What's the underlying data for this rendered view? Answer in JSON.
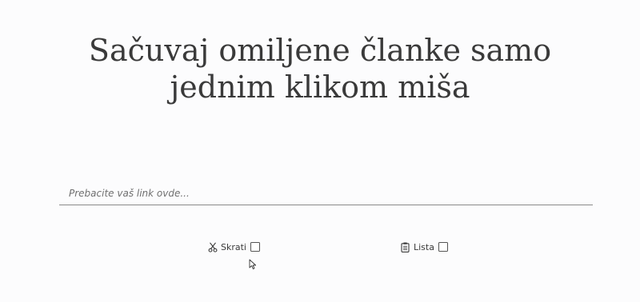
{
  "headline": {
    "line1": "Sačuvaj omiljene članke samo",
    "line2": "jednim klikom miša"
  },
  "link_input": {
    "placeholder": "Prebacite vaš link ovde...",
    "value": ""
  },
  "options": {
    "shorten": {
      "label": "Skrati",
      "icon": "scissors-icon",
      "checked": false
    },
    "list": {
      "label": "Lista",
      "icon": "clipboard-list-icon",
      "checked": false
    }
  },
  "colors": {
    "background": "#fcfcfd",
    "text": "#3a3a3a",
    "underline": "#8a8a8a"
  }
}
